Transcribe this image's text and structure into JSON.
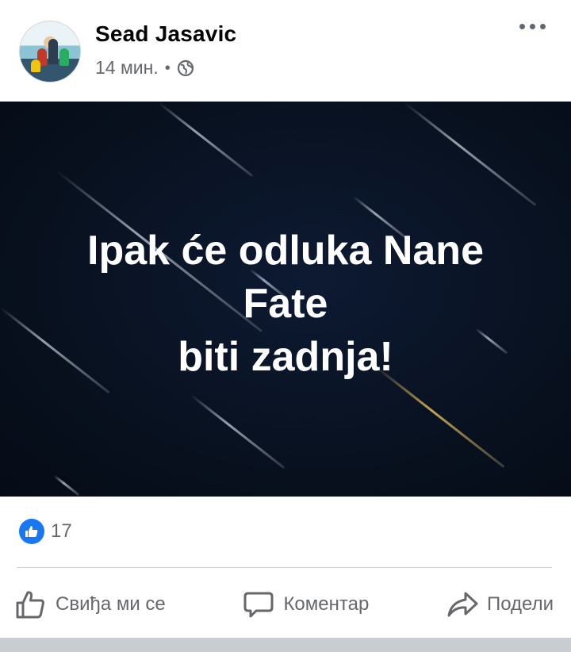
{
  "post": {
    "author": "Sead Jasavic",
    "time": "14 мин.",
    "separator": "•",
    "privacy_icon": "globe-icon",
    "more_icon": "more-icon",
    "text": "Ipak će odluka Nane\nFate\nbiti zadnja!",
    "image_bg_color": "#0a1426"
  },
  "reactions": {
    "icon": "like-reaction-icon",
    "count": "17",
    "accent": "#1877f2"
  },
  "actions": {
    "like": {
      "label": "Свиђа ми се",
      "icon": "thumbs-up-icon"
    },
    "comment": {
      "label": "Коментар",
      "icon": "comment-icon"
    },
    "share": {
      "label": "Подели",
      "icon": "share-icon"
    }
  }
}
